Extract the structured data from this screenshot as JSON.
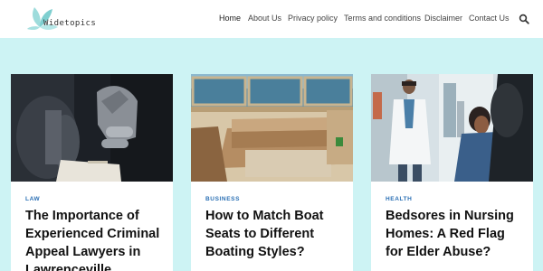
{
  "site": {
    "logo_text": "Widetopics"
  },
  "nav": {
    "items": [
      {
        "label": "Home"
      },
      {
        "label": "About Us"
      },
      {
        "label": "Privacy policy"
      },
      {
        "label": "Terms and conditions"
      },
      {
        "label": "Disclaimer"
      },
      {
        "label": "Contact Us"
      }
    ],
    "search_icon": "search-icon"
  },
  "colors": {
    "page_background": "#cdf3f4",
    "category_accent": "#2a6fb4",
    "logo_leaf": "#8fd6d6"
  },
  "posts": [
    {
      "category": "LAW",
      "title": "The Importance of Experienced Criminal Appeal Lawyers in Lawrenceville",
      "image": "handcuffed-hands-photo"
    },
    {
      "category": "BUSINESS",
      "title": "How to Match Boat Seats to Different Boating Styles?",
      "image": "boat-seats-photo"
    },
    {
      "category": "HEALTH",
      "title": "Bedsores in Nursing Homes: A Red Flag for Elder Abuse?",
      "image": "doctor-hospital-photo"
    }
  ]
}
